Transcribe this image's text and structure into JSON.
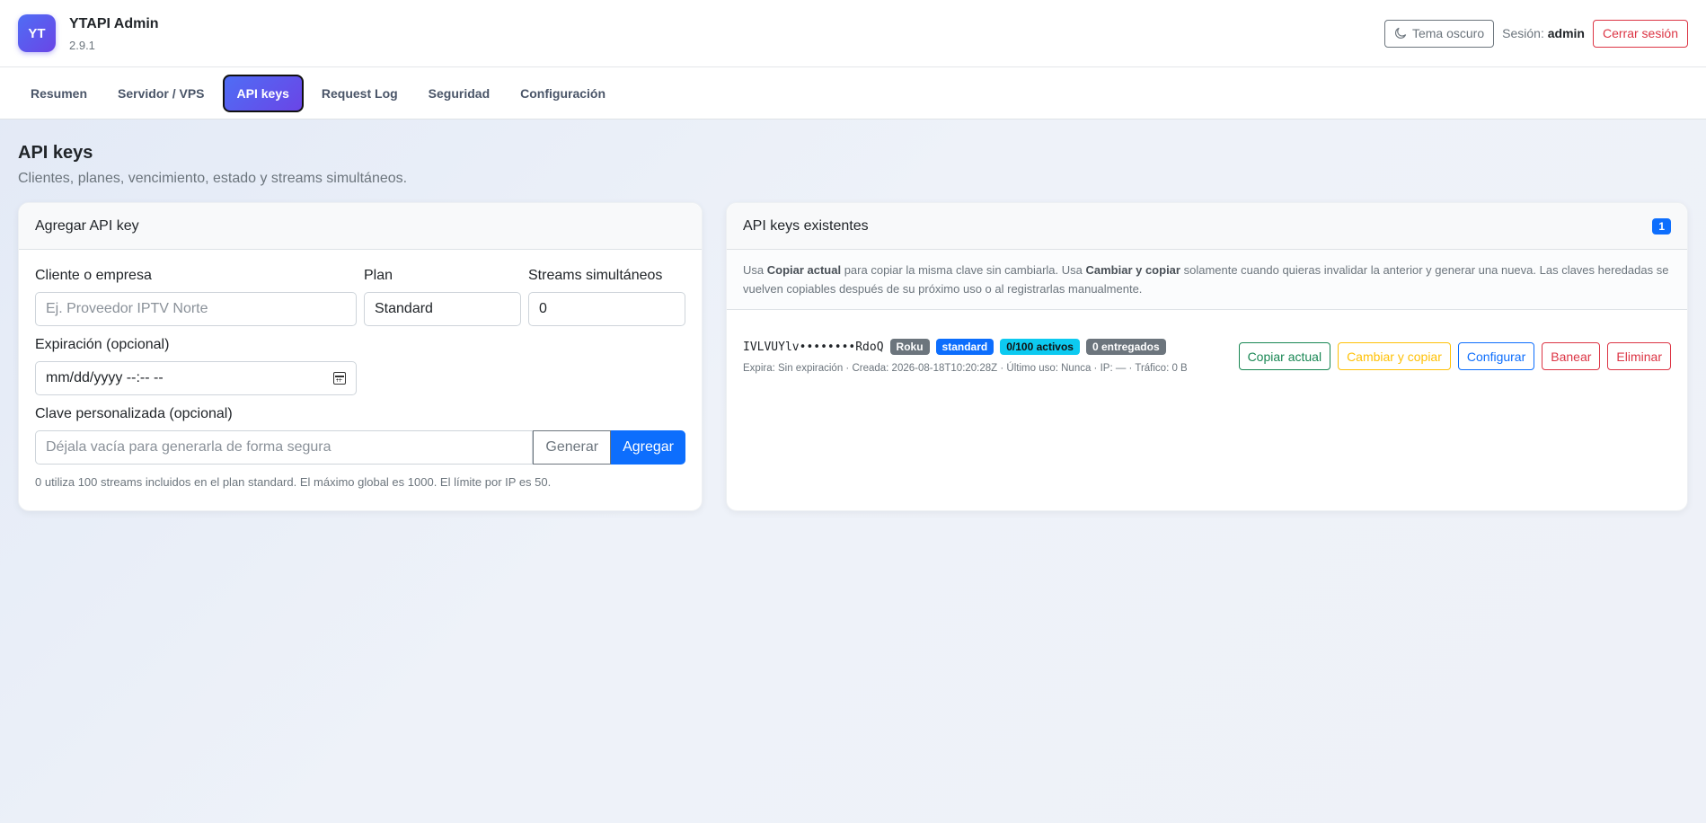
{
  "app": {
    "logo_text": "YT",
    "title": "YTAPI Admin",
    "version": "2.9.1"
  },
  "header": {
    "theme_label": "Tema oscuro",
    "session_prefix": "Sesión:",
    "session_user": "admin",
    "logout_label": "Cerrar sesión"
  },
  "tabs": [
    {
      "label": "Resumen"
    },
    {
      "label": "Servidor / VPS"
    },
    {
      "label": "API keys",
      "active": true
    },
    {
      "label": "Request Log"
    },
    {
      "label": "Seguridad"
    },
    {
      "label": "Configuración"
    }
  ],
  "page": {
    "title": "API keys",
    "subtitle": "Clientes, planes, vencimiento, estado y streams simultáneos."
  },
  "add_form": {
    "card_title": "Agregar API key",
    "client_label": "Cliente o empresa",
    "client_placeholder": "Ej. Proveedor IPTV Norte",
    "plan_label": "Plan",
    "plan_value": "Standard",
    "streams_label": "Streams simultáneos",
    "streams_value": "0",
    "expiration_label": "Expiración (opcional)",
    "expiration_placeholder": "mm/dd/yyyy --:-- --",
    "custom_key_label": "Clave personalizada (opcional)",
    "custom_key_placeholder": "Déjala vacía para generarla de forma segura",
    "generate_label": "Generar",
    "add_label": "Agregar",
    "help_text": "0 utiliza 100 streams incluidos en el plan standard. El máximo global es 1000. El límite por IP es 50."
  },
  "existing": {
    "card_title": "API keys existentes",
    "count": "1",
    "info_1": "Usa ",
    "info_b1": "Copiar actual",
    "info_2": " para copiar la misma clave sin cambiarla. Usa ",
    "info_b2": "Cambiar y copiar",
    "info_3": " solamente cuando quieras invalidar la anterior y generar una nueva. Las claves heredadas se vuelven copiables después de su próximo uso o al registrarlas manualmente.",
    "keys": [
      {
        "masked_key": "IVLVUYlv••••••••RdoQ",
        "client_badge": "Roku",
        "plan_badge": "standard",
        "active_badge": "0/100 activos",
        "delivered_badge": "0 entregados",
        "meta": "Expira: Sin expiración · Creada: 2026-08-18T10:20:28Z · Último uso: Nunca · IP: — · Tráfico: 0 B",
        "actions": {
          "copy": "Copiar actual",
          "rotate": "Cambiar y copiar",
          "configure": "Configurar",
          "ban": "Banear",
          "delete": "Eliminar"
        }
      }
    ]
  }
}
